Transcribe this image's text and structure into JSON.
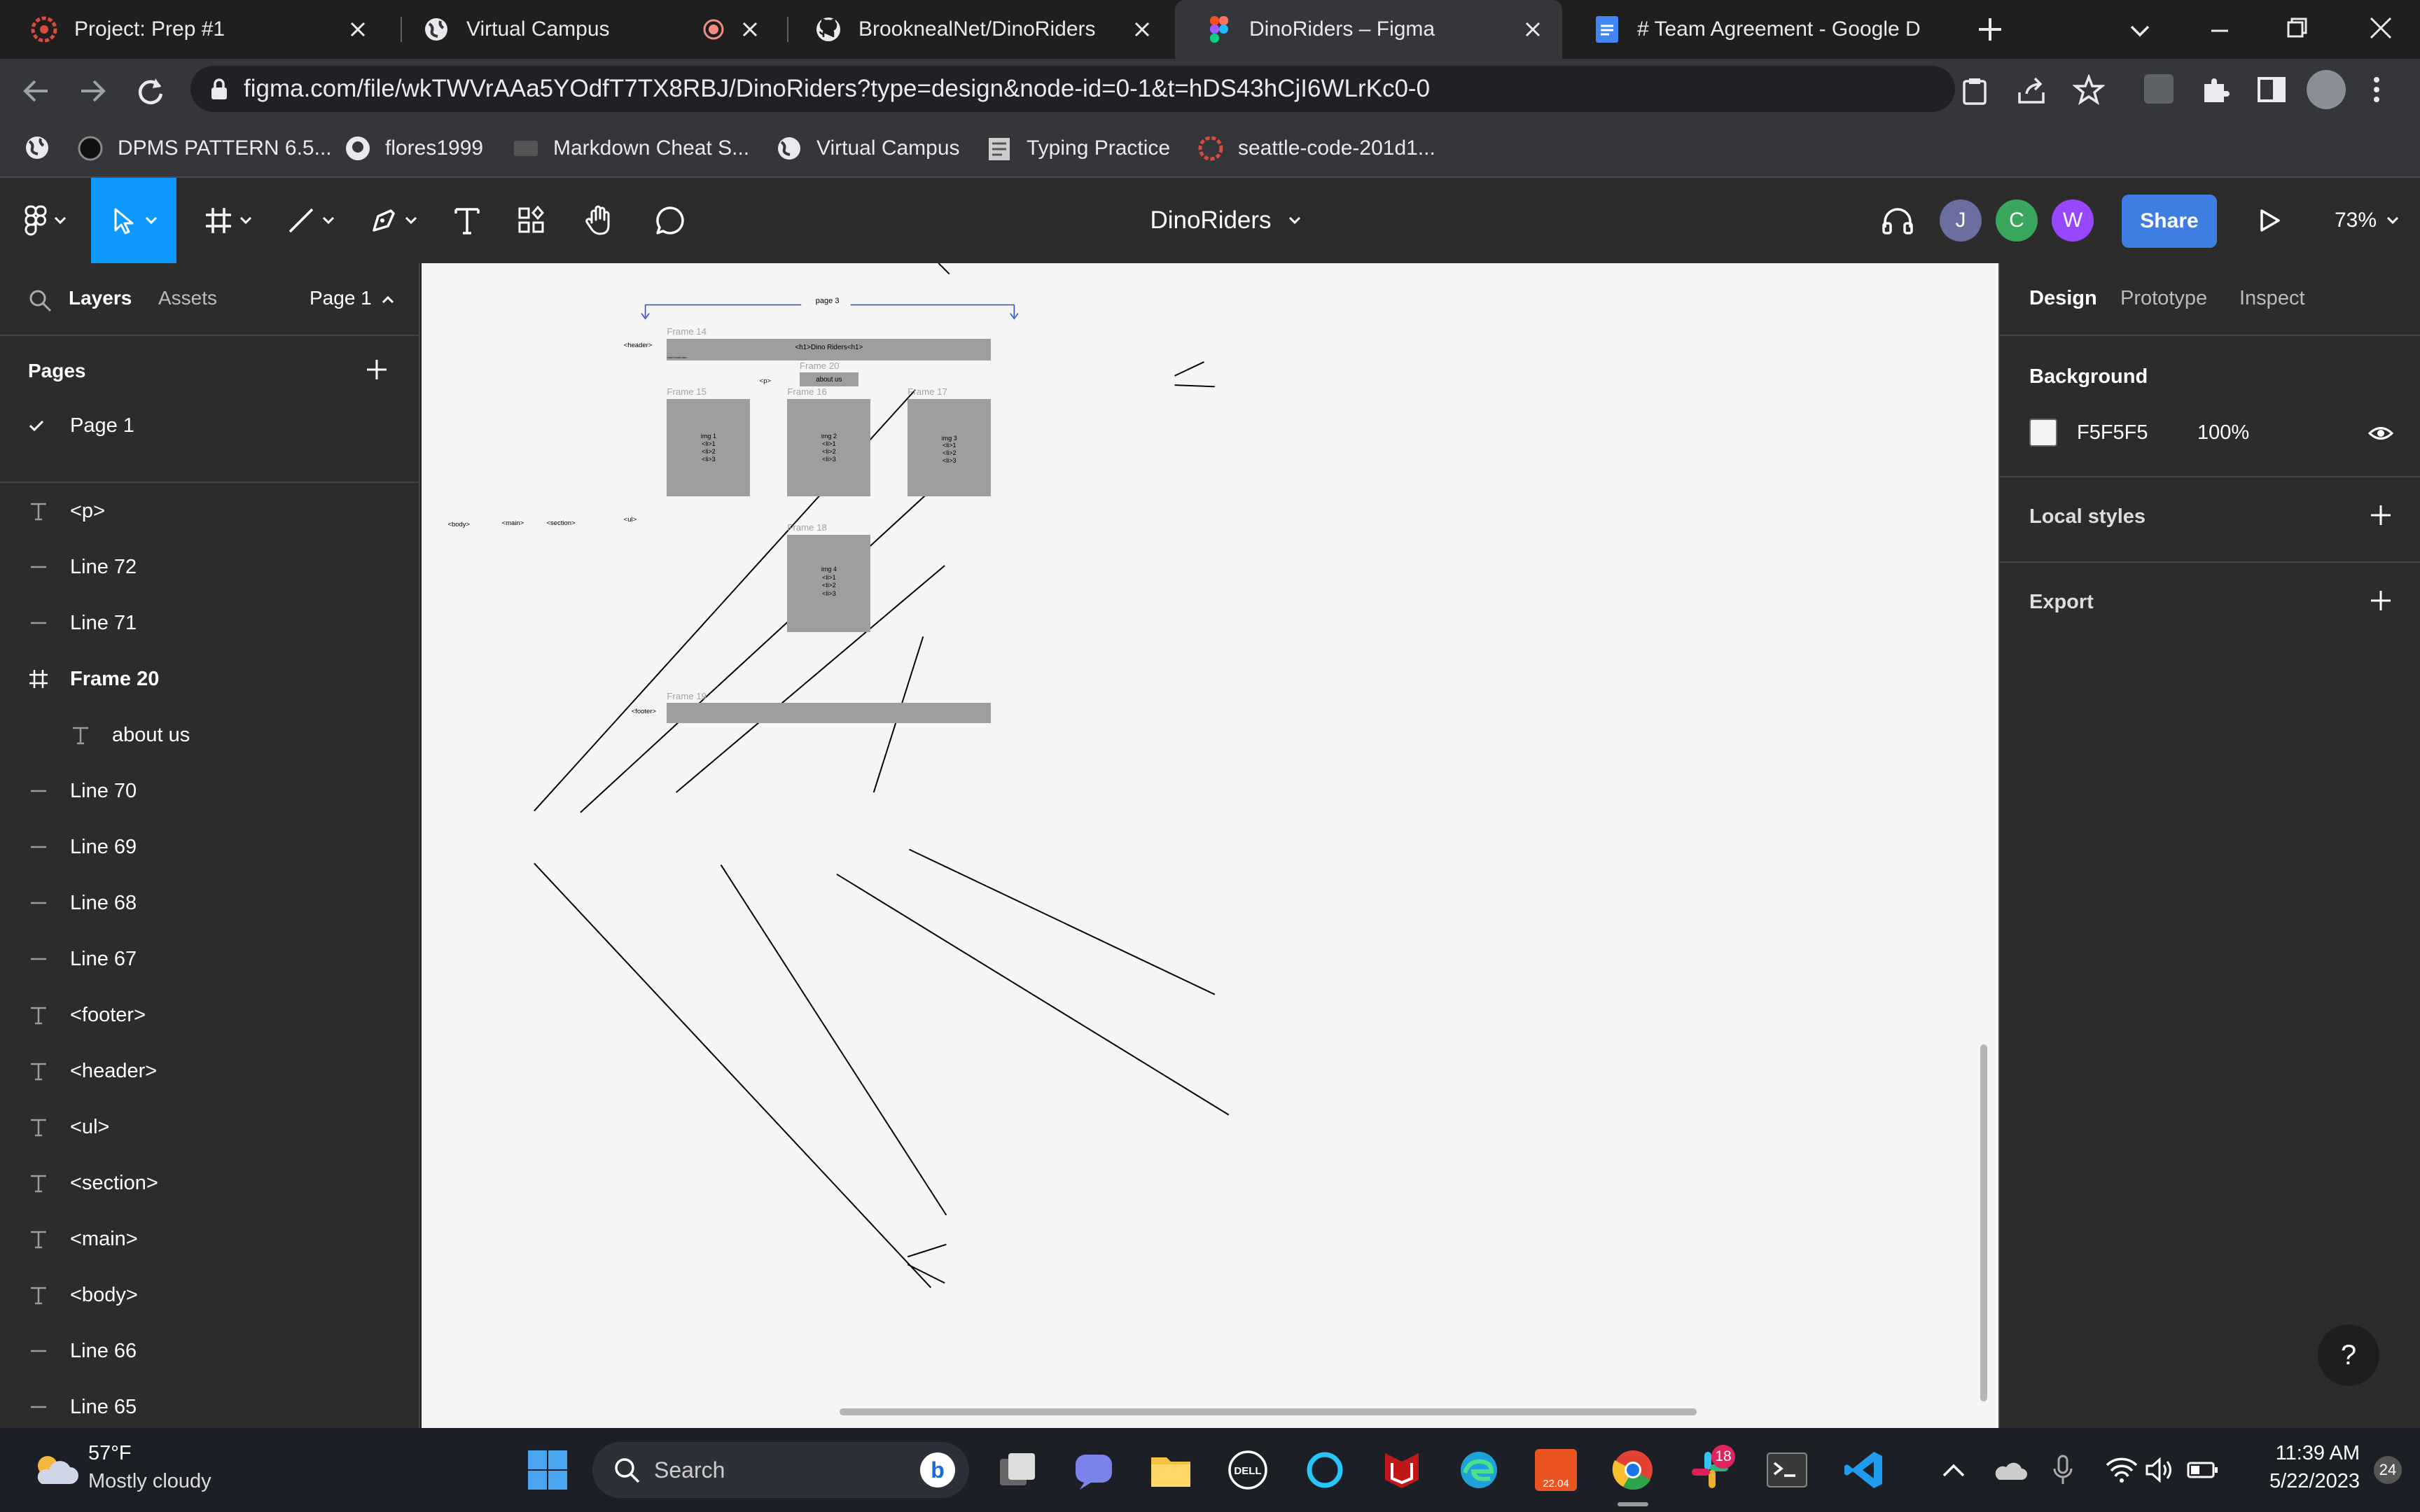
{
  "browser": {
    "tabs": [
      {
        "title": "Project: Prep #1",
        "icon": "codefellows-icon"
      },
      {
        "title": "Virtual Campus",
        "icon": "globe-icon"
      },
      {
        "title": "BrooknealNet/DinoRiders",
        "icon": "github-icon"
      },
      {
        "title": "DinoRiders – Figma",
        "icon": "figma-icon"
      },
      {
        "title": "# Team Agreement - Google D",
        "icon": "google-docs-icon"
      }
    ],
    "url": "figma.com/file/wkTWVrAAa5YOdfT7TX8RBJ/DinoRiders?type=design&node-id=0-1&t=hDS43hCjI6WLrKc0-0",
    "bookmarks": [
      "DPMS PATTERN 6.5...",
      "flores1999",
      "Markdown Cheat S...",
      "Virtual Campus",
      "Typing Practice",
      "seattle-code-201d1..."
    ]
  },
  "figma": {
    "file_name": "DinoRiders",
    "avatars": [
      "J",
      "C",
      "W"
    ],
    "share_label": "Share",
    "zoom": "73%",
    "left_tabs": {
      "layers": "Layers",
      "assets": "Assets",
      "page": "Page 1"
    },
    "pages_heading": "Pages",
    "pages": [
      "Page 1"
    ],
    "layers": [
      {
        "name": "<p>",
        "type": "text"
      },
      {
        "name": "Line 72",
        "type": "line"
      },
      {
        "name": "Line 71",
        "type": "line"
      },
      {
        "name": "Frame 20",
        "type": "frame"
      },
      {
        "name": "about us",
        "type": "text",
        "child": true
      },
      {
        "name": "Line 70",
        "type": "line"
      },
      {
        "name": "Line 69",
        "type": "line"
      },
      {
        "name": "Line 68",
        "type": "line"
      },
      {
        "name": "Line 67",
        "type": "line"
      },
      {
        "name": "<footer>",
        "type": "text"
      },
      {
        "name": "<header>",
        "type": "text"
      },
      {
        "name": "<ul>",
        "type": "text"
      },
      {
        "name": "<section>",
        "type": "text"
      },
      {
        "name": "<main>",
        "type": "text"
      },
      {
        "name": "<body>",
        "type": "text"
      },
      {
        "name": "Line 66",
        "type": "line"
      },
      {
        "name": "Line 65",
        "type": "line"
      }
    ],
    "right_tabs": [
      "Design",
      "Prototype",
      "Inspect"
    ],
    "background_label": "Background",
    "background_hex": "F5F5F5",
    "background_opacity": "100%",
    "local_styles": "Local styles",
    "export": "Export",
    "help": "?"
  },
  "canvas": {
    "page_label": "page 3",
    "frames": {
      "f14": {
        "name": "Frame 14",
        "text": "<h1>Dino Riders<h1>",
        "nav": "<nav>Home<nav>"
      },
      "f20": {
        "name": "Frame 20",
        "text": "about us"
      },
      "f15": {
        "name": "Frame 15",
        "lines": [
          "img 1",
          "<li>1",
          "<li>2",
          "<li>3"
        ]
      },
      "f16": {
        "name": "Frame 16",
        "lines": [
          "img 2",
          "<li>1",
          "<li>2",
          "<li>3"
        ]
      },
      "f17": {
        "name": "Frame 17",
        "lines": [
          "img 3",
          "<li>1",
          "<li>2",
          "<li>3"
        ]
      },
      "f18": {
        "name": "Frame 18",
        "lines": [
          "img 4",
          "<li>1",
          "<li>2",
          "<li>3"
        ]
      },
      "f19": {
        "name": "Frame 19"
      }
    },
    "labels": {
      "header": "<header>",
      "p": "<p>",
      "body": "<body>",
      "main": "<main>",
      "section": "<section>",
      "ul": "<ul>",
      "footer": "<footer>"
    }
  },
  "taskbar": {
    "weather_temp": "57°F",
    "weather_desc": "Mostly cloudy",
    "search": "Search",
    "slack_badge": "18",
    "ubuntu_label": "22.04",
    "time": "11:39 AM",
    "date": "5/22/2023",
    "notif_count": "24"
  },
  "colors": {
    "accent": "#0d99ff",
    "share": "#3e7ee3",
    "avatar_j": "#6b6f9f",
    "avatar_c": "#3aa55c",
    "avatar_w": "#9747ff",
    "frame_fill": "#9e9e9e"
  }
}
